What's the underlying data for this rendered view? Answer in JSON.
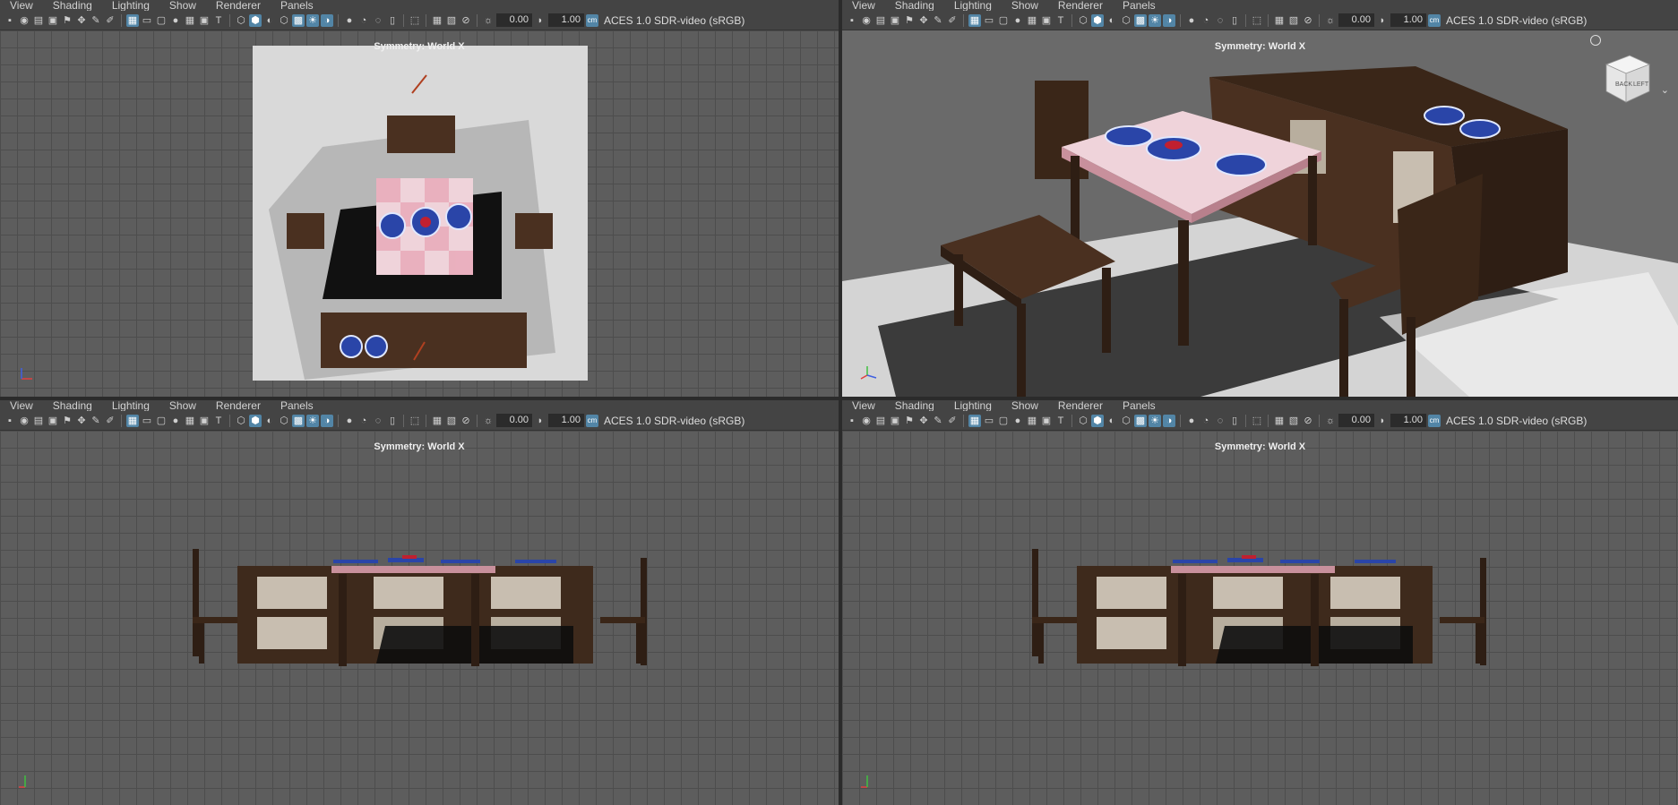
{
  "menu": [
    "View",
    "Shading",
    "Lighting",
    "Show",
    "Renderer",
    "Panels"
  ],
  "toolbar": {
    "exposure": "0.00",
    "gamma": "1.00",
    "color_management_icon": "cm-icon",
    "color_transform": "ACES 1.0 SDR-video (sRGB)"
  },
  "panels": [
    {
      "id": "top",
      "symmetry": "Symmetry: World X"
    },
    {
      "id": "persp",
      "symmetry": "Symmetry: World X",
      "viewcube": {
        "front_face": "BACK",
        "side_face": "LEFT"
      }
    },
    {
      "id": "front",
      "symmetry": "Symmetry: World X"
    },
    {
      "id": "side",
      "symmetry": "Symmetry: World X"
    }
  ],
  "colors": {
    "panel_bg": "#5d5d5d",
    "toolbar_bg": "#444444",
    "accent": "#5285a6",
    "wood": "#3e2a1c",
    "table_cloth": "#e8b7c2",
    "floor": "#d9d9d9",
    "plate": "#2a45a8"
  }
}
